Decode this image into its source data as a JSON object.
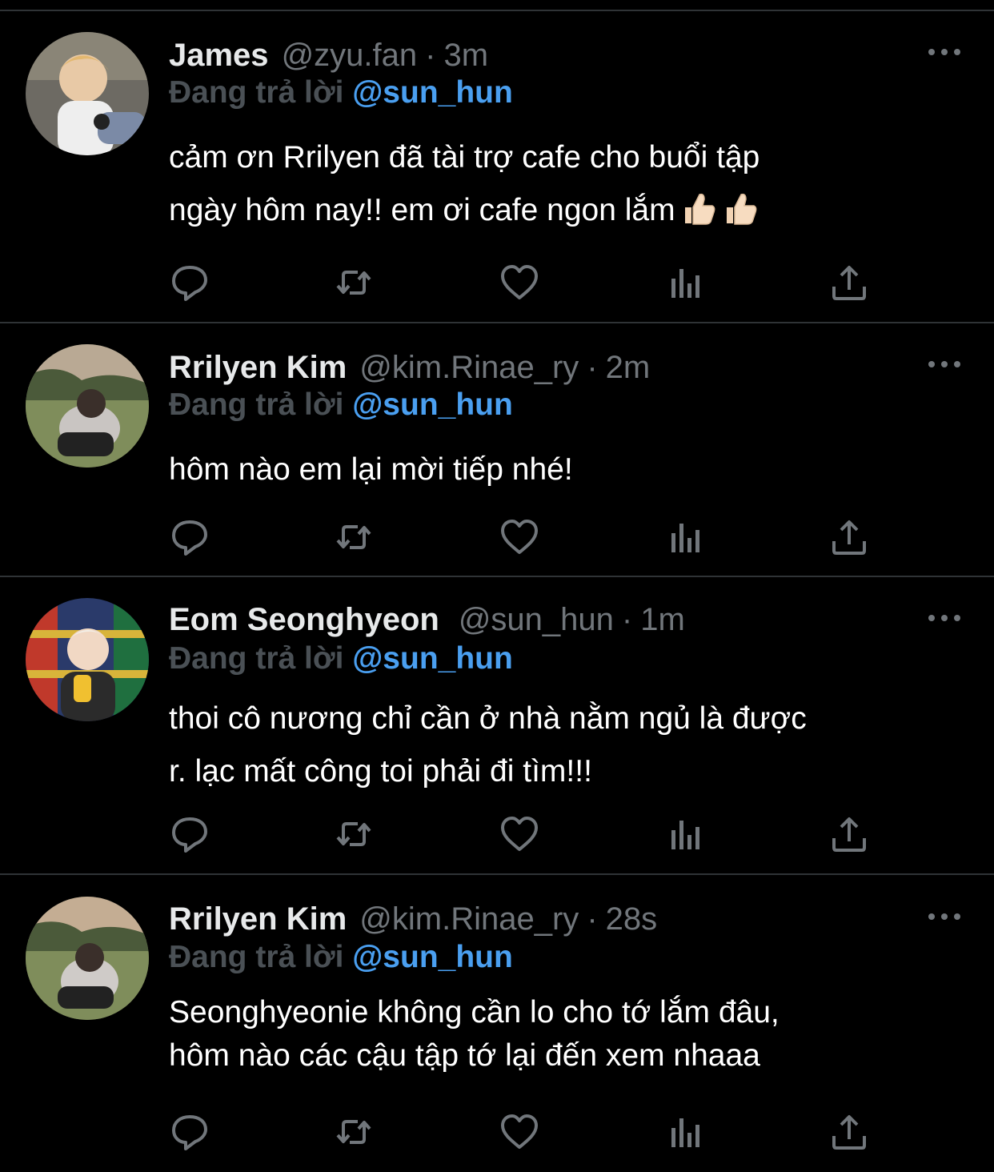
{
  "reply_prefix": "Đang trả lời",
  "tweets": [
    {
      "name": "James",
      "handle": "@zyu.fan",
      "dot": "·",
      "time": "3m",
      "mention": "@sun_hun",
      "text": "cảm ơn Rrilyen đã tài trợ cafe cho buổi tập\nngày hôm nay!! em ơi cafe ngon lắm",
      "emoji": "thumbs-up-icon x2"
    },
    {
      "name": "Rrilyen Kim",
      "handle": "@kim.Rinae_ry",
      "dot": "·",
      "time": "2m",
      "mention": "@sun_hun",
      "text": "hôm nào em lại mời tiếp nhé!"
    },
    {
      "name": "Eom Seonghyeon",
      "handle": "@sun_hun",
      "dot": "·",
      "time": "1m",
      "mention": "@sun_hun",
      "text": "thoi cô nương chỉ cần ở nhà nằm ngủ là được\nr. lạc mất công toi phải đi tìm!!!"
    },
    {
      "name": "Rrilyen Kim",
      "handle": "@kim.Rinae_ry",
      "dot": "·",
      "time": "28s",
      "mention": "@sun_hun",
      "text": "Seonghyeonie không cần lo cho tớ lắm đâu,\nhôm nào các cậu tập tớ lại đến xem nhaaa"
    }
  ],
  "icons": [
    "reply-icon",
    "retweet-icon",
    "like-icon",
    "analytics-icon",
    "share-icon",
    "more-icon"
  ],
  "colors": {
    "background": "#000000",
    "text": "#ffffff",
    "muted": "#71767b",
    "mention": "#4a9ff0",
    "divider": "#2f3336"
  }
}
